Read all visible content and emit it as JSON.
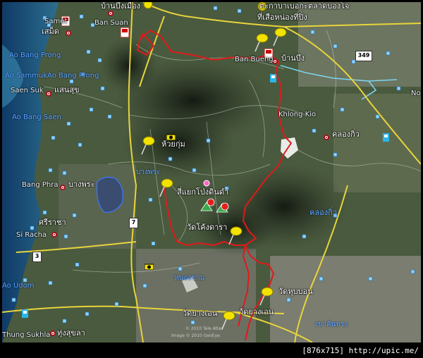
{
  "footer": {
    "text": "[876x715] http://upic.me/"
  },
  "credit": {
    "line1": "© 2010 Tele Atlas",
    "line2": "Image © 2010 GeoEye"
  },
  "labels": {
    "samet_en": "Samet",
    "samet_th": "เสม็ด",
    "bansuan_th": "บ้านบึงเมือง",
    "bansuan_en": "Ban Suan",
    "top_right_th": "ตะกาบาเบอกะตลาดบองโจ",
    "sua_th": "ที่เสือหน่องที่ปิ่ง",
    "aobangprong": "Ao Bang Prong",
    "aosammuk": "Ao SammukAo Bang Prong",
    "saensuk_en": "Saen Suk",
    "saensuk_th": "แสนสุข",
    "aobangsaen": "Ao Bang Saen",
    "banbueng_en": "Ban Bueng",
    "banbueng_th": "บ้านบึง",
    "khlongkio_en": "Khlong Kio",
    "khlongkio_th": "คลองกิ่ว",
    "no_edge": "No",
    "huaikum_th": "ห้วยกุ่ม",
    "bangphra_small": "บางพระ",
    "bangphra_en": "Bang Phra",
    "bangphra_th": "บางพระ",
    "sayaek_th": "สี่แยกโป่งดินดำ",
    "khlongkio_blue": "คลองกิ่ว",
    "sriracha_th": "ศรีราชา",
    "siracha_en": "Si Racha",
    "wat_kheng": "วัดโค้งดารา",
    "aoudom": "Ao Udom",
    "nongkham": "หนองขาม",
    "wat_nubon": "วัดหุบบอน",
    "wat_yangen1": "วัดยางเอน",
    "wat_yangen2": "วัดยางเอน",
    "khaokanthong": "เขาคันทรง",
    "thung_en": "Thung Sukhla",
    "thung_th": "ทุ่งสุขลา"
  },
  "shields": {
    "r349": "349",
    "r7": "7",
    "r3": "3"
  },
  "colors": {
    "route": "#e01a1a",
    "road": "#e8d43c",
    "sea": "#1f5a8c",
    "label_blue": "#5ea8ff"
  }
}
